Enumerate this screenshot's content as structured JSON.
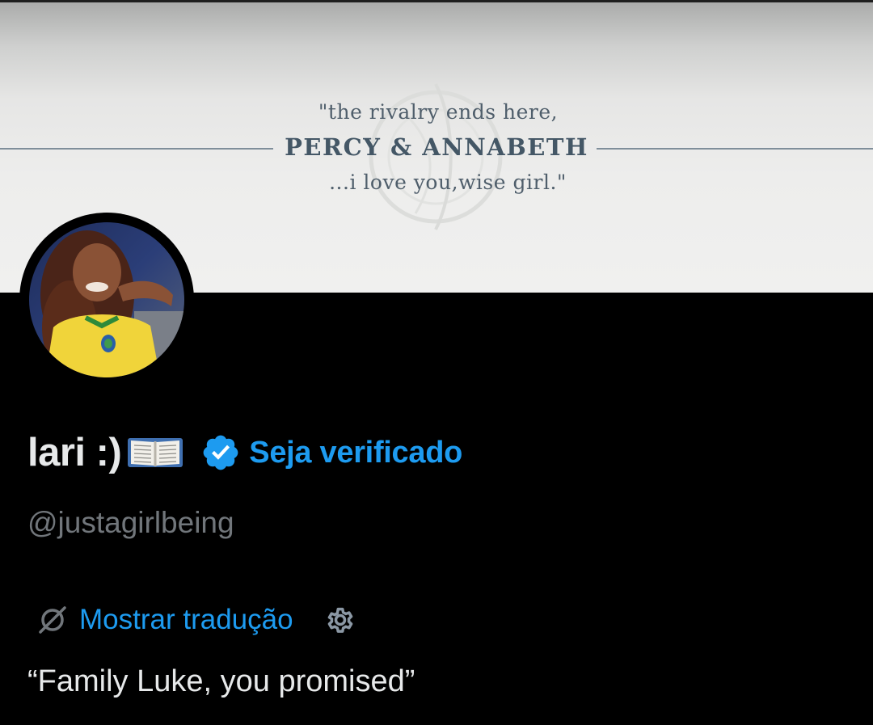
{
  "banner": {
    "quote_top": "\"the rivalry ends here,",
    "quote_mid": "PERCY & ANNABETH",
    "quote_bottom": "...i love you,wise girl.\""
  },
  "profile": {
    "display_name": "lari :)",
    "name_emoji": "open-book-icon",
    "verified_icon": "verified-badge-icon",
    "get_verified_label": "Seja verificado",
    "handle": "@justagirlbeing"
  },
  "translation": {
    "icon": "translate-icon",
    "link_label": "Mostrar tradução",
    "settings_icon": "gear-icon"
  },
  "bio": {
    "text": "“Family Luke, you promised”"
  },
  "colors": {
    "background": "#000000",
    "accent": "#1d9bf0",
    "primary_text": "#e7e9ea",
    "secondary_text": "#71767b"
  }
}
